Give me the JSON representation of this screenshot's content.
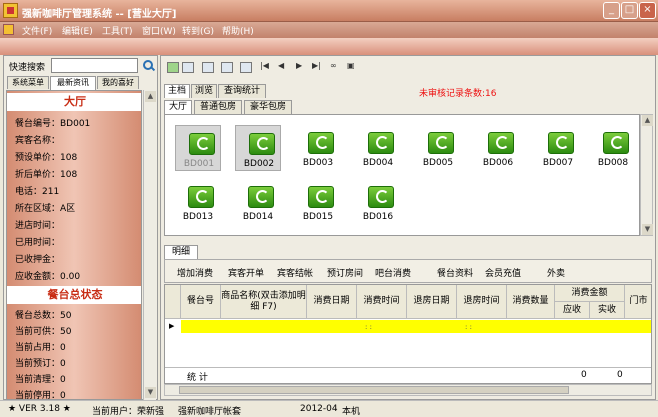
{
  "window": {
    "title": "强新咖啡厅管理系统 -- [营业大厅]",
    "min": "_",
    "max": "□",
    "close": "×"
  },
  "menu": [
    "文件(F)",
    "编辑(E)",
    "工具(T)",
    "窗口(W)",
    "转到(G)",
    "帮助(H)"
  ],
  "left": {
    "search_label": "快速搜索",
    "search_value": "",
    "tabs": [
      "系统菜单",
      "最新资讯",
      "我的喜好"
    ],
    "hall_title": "大厅",
    "hall_rows": [
      "餐台编号：BD001",
      "宾客名称：",
      "预设单价：108",
      "折后单价：108",
      "电话：211",
      "所在区域：A区",
      "进店时间：",
      "已用时间：",
      "已收押金：",
      "应收金额：0.00"
    ],
    "status_title": "餐台总状态",
    "status_rows": [
      "餐台总数：50",
      "当前可供：50",
      "当前占用：0",
      "当前预订：0",
      "当前清理：0",
      "当前停用：0"
    ]
  },
  "main": {
    "tabs": [
      "主档",
      "浏览",
      "查询统计"
    ],
    "unreviewed": "未审核记录条数:16",
    "room_tabs": [
      "大厅",
      "普通包房",
      "豪华包房"
    ],
    "rooms": [
      "BD001",
      "BD002",
      "BD003",
      "BD004",
      "BD005",
      "BD006",
      "BD007",
      "BD008",
      "BD013",
      "BD014",
      "BD015",
      "BD016"
    ],
    "detail_tab": "明细",
    "actions": [
      "增加消费",
      "宾客开单",
      "宾客结帐",
      "预订房间",
      "吧台消费",
      "餐台资料",
      "会员充值",
      "外卖"
    ],
    "columns": [
      "餐台号",
      "商品名称(双击添加明细 F7)",
      "消费日期",
      "消费时间",
      "退房日期",
      "退房时间",
      "消费数量",
      "消费金额",
      "门市"
    ],
    "sub_columns": [
      "应收",
      "实收"
    ],
    "sum_label": "统 计",
    "sum_values": [
      "0",
      "0"
    ],
    "time_placeholder": ": :"
  },
  "status": {
    "version": "★ VER 3.18 ★",
    "user": "当前用户：荣新强",
    "company": "强新咖啡厅帐套",
    "date": "2012-04",
    "location": "本机"
  }
}
